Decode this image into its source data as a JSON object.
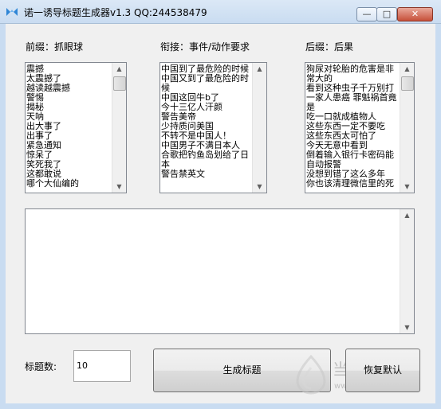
{
  "window": {
    "title": "诺一诱导标题生成器v1.3 QQ:244538479",
    "btn_min": "—",
    "btn_max": "□",
    "btn_close": "✕"
  },
  "prefix": {
    "label": "前缀：抓眼球",
    "items": [
      "震撼",
      "太震撼了",
      "越读越震撼",
      "警惕",
      "揭秘",
      "天呐",
      "出大事了",
      "出事了",
      "紧急通知",
      "惊呆了",
      "笑死我了",
      "这都敢说",
      "哪个大仙编的"
    ]
  },
  "connector": {
    "label": "衔接：事件/动作要求",
    "items": [
      "中国到了最危险的时候",
      "中国又到了最危险的时候",
      "中国这回牛b了",
      "今十三亿人汗颜",
      "警告美帝",
      "少持质问美国",
      "不转不是中国人！",
      "中国男子不满日本人",
      "合歌把钓鱼岛划给了日本",
      "警告禁英文"
    ]
  },
  "suffix": {
    "label": "后缀：后果",
    "items": [
      "狗尿对轮胎的危害是非常大的",
      "看到这种虫子千万别打一家人患癌 罪魁祸首竟是",
      "吃一口就成植物人",
      "这些东西一定不要吃",
      "这些东西太可怕了",
      "今天无意中看到",
      "倒着输入银行卡密码能自动报警",
      "没想到错了这么多年",
      "你也该清理微信里的死"
    ]
  },
  "output": {
    "value": ""
  },
  "count": {
    "label": "标题数:",
    "value": "10"
  },
  "buttons": {
    "generate": "生成标题",
    "reset": "恢复默认"
  },
  "watermark": {
    "text": "当下软件园",
    "url": "www.downxia.com"
  }
}
